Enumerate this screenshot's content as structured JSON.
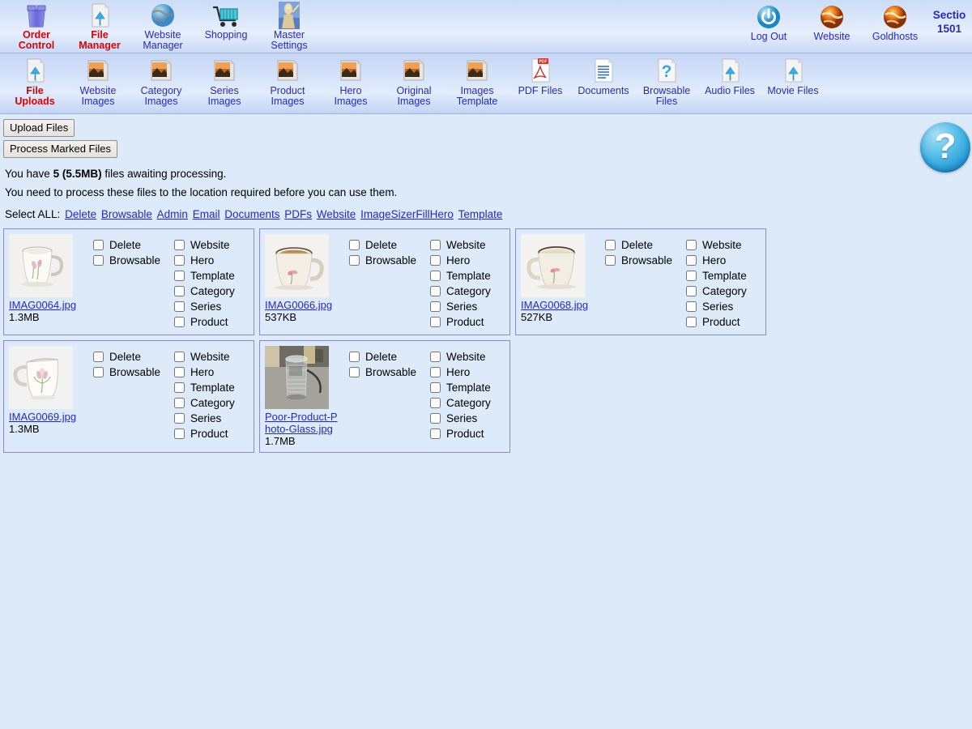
{
  "topnav": {
    "items": [
      {
        "label_line1": "Order",
        "label_line2": "Control",
        "icon": "recycle-bin-icon",
        "active": false
      },
      {
        "label_line1": "File",
        "label_line2": "Manager",
        "icon": "file-upload-icon",
        "active": true
      },
      {
        "label_line1": "Website",
        "label_line2": "Manager",
        "icon": "globe-icon",
        "active": false
      },
      {
        "label_line1": "Shopping",
        "label_line2": "",
        "icon": "shopping-cart-icon",
        "active": false
      },
      {
        "label_line1": "Master",
        "label_line2": "Settings",
        "icon": "zeus-statue-icon",
        "active": false
      }
    ],
    "right_items": [
      {
        "label_line1": "Log Out",
        "label_line2": "",
        "icon": "power-icon"
      },
      {
        "label_line1": "Website",
        "label_line2": "",
        "icon": "fire-globe-icon"
      },
      {
        "label_line1": "Goldhosts",
        "label_line2": "",
        "icon": "fire-globe-icon"
      }
    ],
    "section_line1": "Sectio",
    "section_line2": "1501"
  },
  "subnav": {
    "items": [
      {
        "label_line1": "File",
        "label_line2": "Uploads",
        "icon": "file-upload-icon",
        "active": true
      },
      {
        "label_line1": "Website",
        "label_line2": "Images",
        "icon": "photo-file-icon",
        "active": false
      },
      {
        "label_line1": "Category",
        "label_line2": "Images",
        "icon": "photo-file-icon",
        "active": false
      },
      {
        "label_line1": "Series",
        "label_line2": "Images",
        "icon": "photo-file-icon",
        "active": false
      },
      {
        "label_line1": "Product",
        "label_line2": "Images",
        "icon": "photo-file-icon",
        "active": false
      },
      {
        "label_line1": "Hero",
        "label_line2": "Images",
        "icon": "photo-file-icon",
        "active": false
      },
      {
        "label_line1": "Original",
        "label_line2": "Images",
        "icon": "photo-file-icon",
        "active": false
      },
      {
        "label_line1": "Images",
        "label_line2": "Template",
        "icon": "photo-file-icon",
        "active": false
      },
      {
        "label_line1": "PDF Files",
        "label_line2": "",
        "icon": "pdf-file-icon",
        "active": false
      },
      {
        "label_line1": "Documents",
        "label_line2": "",
        "icon": "document-file-icon",
        "active": false
      },
      {
        "label_line1": "Browsable",
        "label_line2": "Files",
        "icon": "question-file-icon",
        "active": false
      },
      {
        "label_line1": "Audio Files",
        "label_line2": "",
        "icon": "file-upload-icon",
        "active": false
      },
      {
        "label_line1": "Movie Files",
        "label_line2": "",
        "icon": "file-upload-icon",
        "active": false
      }
    ]
  },
  "toolbar": {
    "upload_label": "Upload Files",
    "process_label": "Process Marked Files"
  },
  "status": {
    "line1_pre": "You have ",
    "line1_bold": "5 (5.5MB)",
    "line1_post": " files awaiting processing.",
    "line2": "You need to process these files to the location required before you can use them."
  },
  "select_all": {
    "label": "Select ALL:",
    "links": [
      "Delete",
      "Browsable",
      "Admin",
      "Email",
      "Documents",
      "PDFs",
      "Website",
      "ImageSizerFillHero",
      "Template"
    ]
  },
  "checkbox_labels": {
    "col1": [
      "Delete",
      "Browsable"
    ],
    "col2": [
      "Website",
      "Hero",
      "Template",
      "Category",
      "Series",
      "Product"
    ]
  },
  "files": [
    {
      "name": "IMAG0064.jpg",
      "size": "1.3MB",
      "thumb": "mug-floral-handle-right"
    },
    {
      "name": "IMAG0066.jpg",
      "size": "537KB",
      "thumb": "mug-coffee-filled-handle-right"
    },
    {
      "name": "IMAG0068.jpg",
      "size": "527KB",
      "thumb": "mug-empty-handle-left"
    },
    {
      "name": "IMAG0069.jpg",
      "size": "1.3MB",
      "thumb": "mug-tulip-handle-left"
    },
    {
      "name": "Poor-Product-Photo-Glass.jpg",
      "size": "1.7MB",
      "thumb": "glass-tumbler-cluttered"
    }
  ],
  "help": {
    "glyph": "?"
  },
  "colors": {
    "accent_blue": "#2a2ab8",
    "active_red": "#e00000",
    "page_bg": "#dceaf9",
    "card_border": "#8a8ac4",
    "help_blue": "#2096d4"
  }
}
